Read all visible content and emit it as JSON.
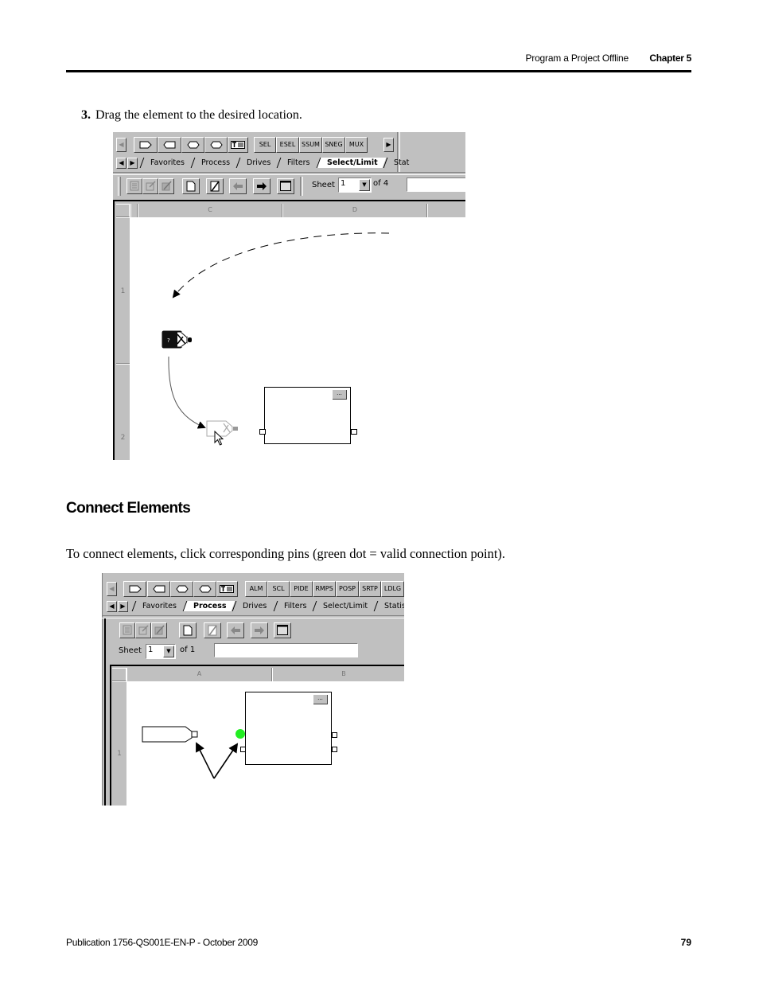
{
  "header": {
    "section": "Program a Project Offline",
    "chapter": "Chapter 5"
  },
  "step": {
    "number": "3.",
    "text": "Drag the element to the desired location."
  },
  "screenshot1": {
    "palette_buttons": [
      "SEL",
      "ESEL",
      "SSUM",
      "SNEG",
      "MUX"
    ],
    "shape_buttons": [
      "input-reference-icon",
      "output-reference-icon",
      "input-wire-connector-icon",
      "output-wire-connector-icon",
      "text-box-icon"
    ],
    "tabs": [
      "Favorites",
      "Process",
      "Drives",
      "Filters",
      "Select/Limit",
      "Stat"
    ],
    "active_tab": "Select/Limit",
    "sheet_label": "Sheet",
    "sheet_value": "1",
    "sheet_of": "of 4",
    "sheet_name_value": "",
    "columns": [
      "C",
      "D"
    ],
    "rows": [
      "1",
      "2"
    ],
    "element_placeholder": "?",
    "block_button": "..."
  },
  "section": {
    "title": "Connect Elements",
    "paragraph": "To connect elements, click corresponding pins (green dot = valid connection point)."
  },
  "screenshot2": {
    "palette_buttons": [
      "ALM",
      "SCL",
      "PIDE",
      "RMPS",
      "POSP",
      "SRTP",
      "LDLG"
    ],
    "tabs": [
      "Favorites",
      "Process",
      "Drives",
      "Filters",
      "Select/Limit",
      "Statistica"
    ],
    "active_tab": "Process",
    "sheet_label": "Sheet",
    "sheet_value": "1",
    "sheet_of": "of 1",
    "sheet_name_value": "",
    "columns": [
      "A",
      "B"
    ],
    "rows": [
      "1"
    ],
    "block_button": "...",
    "valid_pin_color": "#22ee22"
  },
  "footer": {
    "publication": "Publication 1756-QS001E-EN-P - October 2009",
    "page": "79"
  }
}
